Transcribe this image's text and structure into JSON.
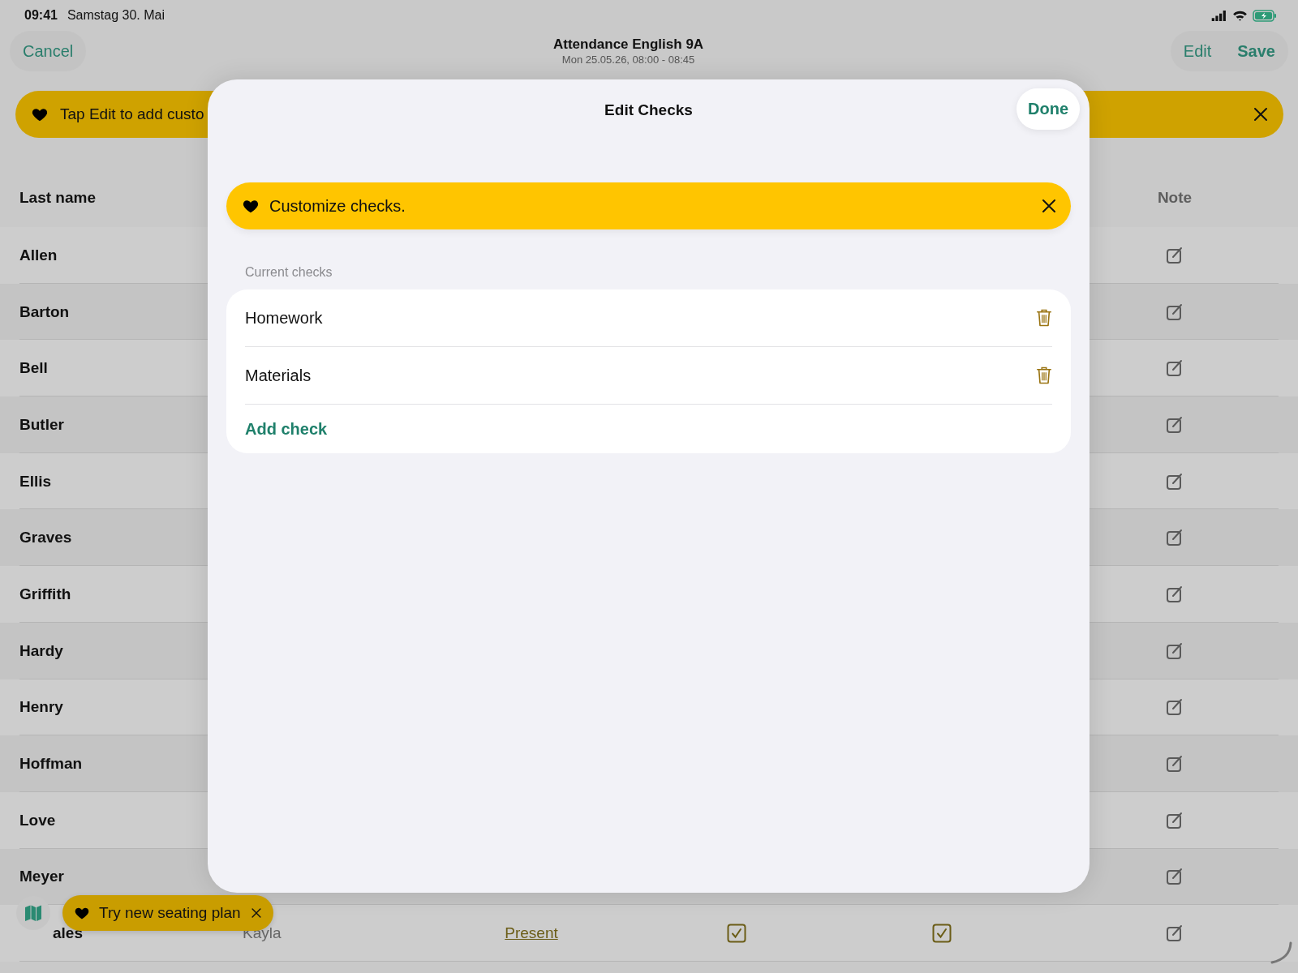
{
  "status_bar": {
    "time": "09:41",
    "date": "Samstag 30. Mai"
  },
  "nav": {
    "cancel": "Cancel",
    "title": "Attendance English 9A",
    "subtitle": "Mon 25.05.26, 08:00 - 08:45",
    "edit": "Edit",
    "save": "Save"
  },
  "hint_banner": {
    "text": "Tap Edit to add custo"
  },
  "table": {
    "columns": [
      {
        "label": "Last name"
      },
      {
        "label": "Note"
      }
    ],
    "rows": [
      {
        "last_name": "Allen"
      },
      {
        "last_name": "Barton"
      },
      {
        "last_name": "Bell"
      },
      {
        "last_name": "Butler"
      },
      {
        "last_name": "Ellis"
      },
      {
        "last_name": "Graves"
      },
      {
        "last_name": "Griffith"
      },
      {
        "last_name": "Hardy"
      },
      {
        "last_name": "Henry"
      },
      {
        "last_name": "Hoffman"
      },
      {
        "last_name": "Love"
      },
      {
        "last_name": "Meyer"
      },
      {
        "last_name": "ales",
        "first_name": "Kayla",
        "status": "Present",
        "check_1": true,
        "check_2": true
      }
    ]
  },
  "modal": {
    "title": "Edit Checks",
    "done": "Done",
    "banner": {
      "text": "Customize checks."
    },
    "section_label": "Current checks",
    "checks": [
      {
        "name": "Homework"
      },
      {
        "name": "Materials"
      }
    ],
    "add_label": "Add check"
  },
  "seating_toast": {
    "text": "Try new seating plan"
  }
}
